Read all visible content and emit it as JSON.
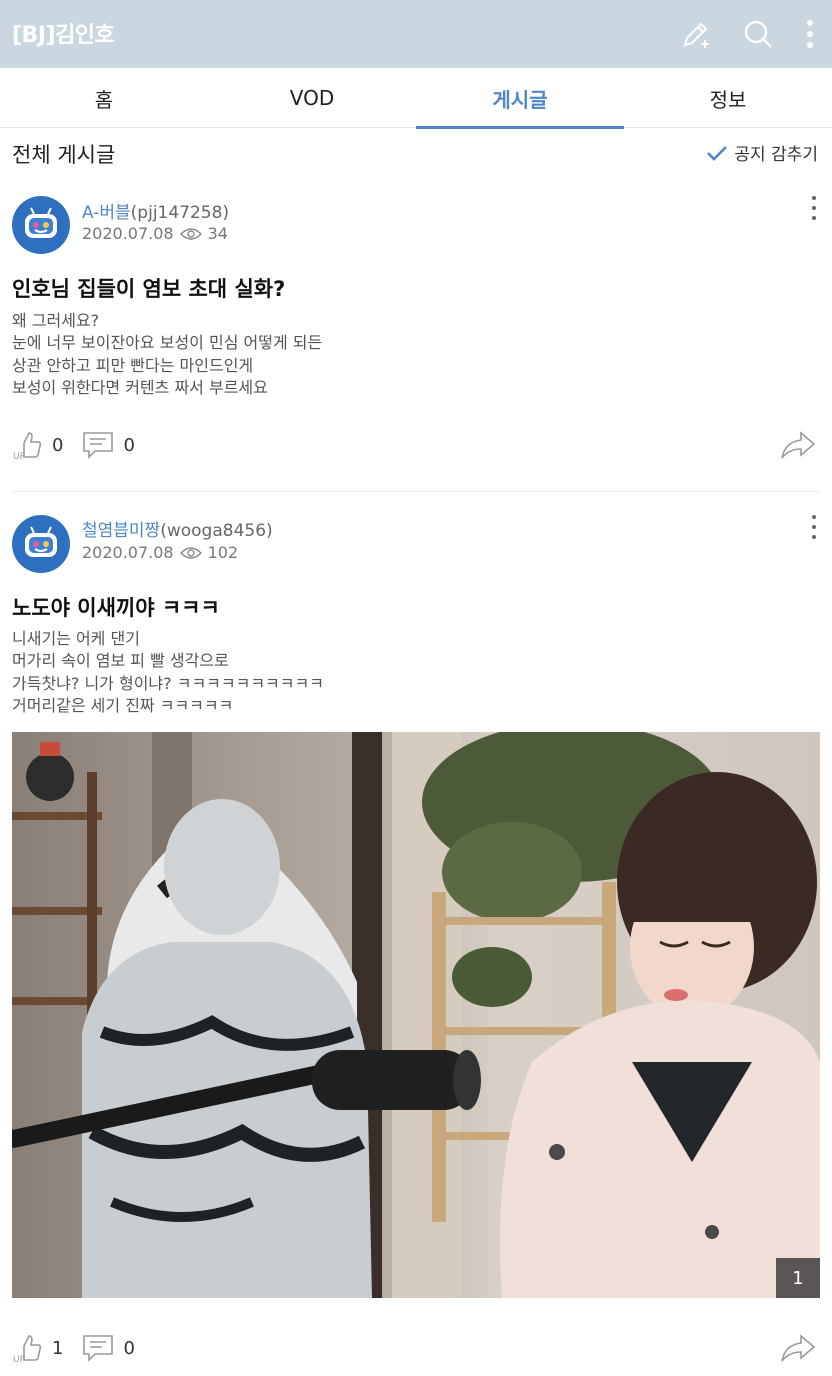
{
  "appbar": {
    "title": "[BJ]김인호",
    "icons": [
      "pencil-plus-icon",
      "search-icon",
      "more-vertical-icon"
    ],
    "background": "#cbd7e0"
  },
  "tabs": [
    {
      "label": "홈",
      "active": false
    },
    {
      "label": "VOD",
      "active": false
    },
    {
      "label": "게시글",
      "active": true
    },
    {
      "label": "정보",
      "active": false
    }
  ],
  "accent_color": "#4f86c6",
  "section": {
    "title": "전체 게시글",
    "notice_toggle_label": "공지 감추기"
  },
  "posts": [
    {
      "nickname": "A-버블",
      "user_id": "(pjj147258)",
      "date": "2020.07.08",
      "views": "34",
      "title": "인호님 집들이 염보 초대 실화?",
      "body": [
        "왜 그러세요?",
        "눈에 너무 보이잔아요 보성이 민심 어떻게 되든",
        "상관 안하고 피만 빤다는 마인드인게",
        "보성이 위한다면 커텐츠 짜서 부르세요"
      ],
      "likes": "0",
      "comments": "0"
    },
    {
      "nickname": "철염븝미짱",
      "user_id": "(wooga8456)",
      "date": "2020.07.08",
      "views": "102",
      "title": "노도야 이새끼야 ㅋㅋㅋ",
      "body": [
        "니새기는 어케 댄기",
        "머가리 속이 염보 피 빨 생각으로",
        "가득찻냐? 니가 형이냐? ㅋㅋㅋㅋㅋㅋㅋㅋㅋㅋ",
        "거머리같은 세기 진짜 ㅋㅋㅋㅋㅋ"
      ],
      "image_count": "1",
      "likes": "1",
      "comments": "0"
    }
  ]
}
